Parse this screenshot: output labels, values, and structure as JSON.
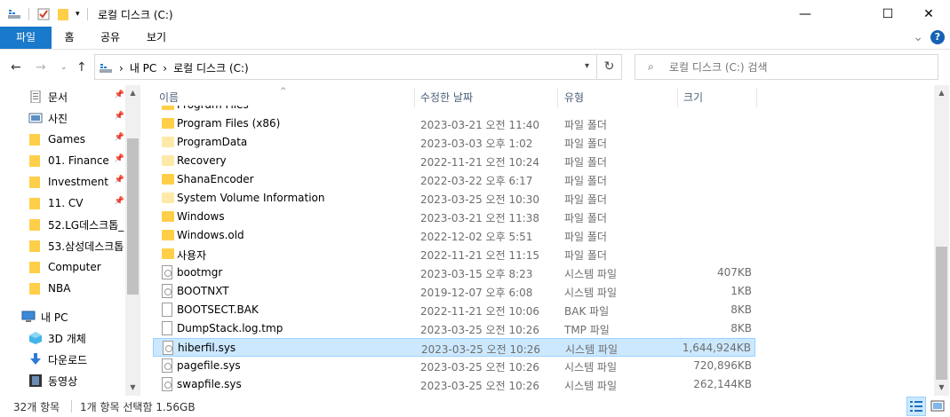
{
  "window": {
    "title": "로컬 디스크 (C:)",
    "minimize_glyph": "—",
    "maximize_glyph": "☐",
    "close_glyph": "✕"
  },
  "ribbon": {
    "tabs": [
      {
        "label": "파일"
      },
      {
        "label": "홈"
      },
      {
        "label": "공유"
      },
      {
        "label": "보기"
      }
    ],
    "help_glyph": "?",
    "expand_glyph": "⌄"
  },
  "address": {
    "crumbs": [
      "내 PC",
      "로컬 디스크 (C:)"
    ],
    "separator": "›"
  },
  "search": {
    "placeholder": "로컬 디스크 (C:) 검색"
  },
  "nav_pane": {
    "items": [
      {
        "label": "문서",
        "icon": "documents-icon",
        "pinned": true
      },
      {
        "label": "사진",
        "icon": "pictures-icon",
        "pinned": true
      },
      {
        "label": "Games",
        "icon": "folder-icon",
        "pinned": true
      },
      {
        "label": "01. Finance",
        "icon": "folder-icon",
        "pinned": true
      },
      {
        "label": "Investment",
        "icon": "folder-icon",
        "pinned": true
      },
      {
        "label": "11. CV",
        "icon": "folder-icon",
        "pinned": true
      },
      {
        "label": "52.LG데스크톱_",
        "icon": "folder-icon",
        "pinned": false
      },
      {
        "label": "53.삼성데스크톱",
        "icon": "folder-icon",
        "pinned": false
      },
      {
        "label": "Computer",
        "icon": "folder-icon",
        "pinned": false
      },
      {
        "label": "NBA",
        "icon": "folder-icon",
        "pinned": false
      },
      {
        "label": "내 PC",
        "icon": "pc-icon",
        "pinned": false
      },
      {
        "label": "3D 개체",
        "icon": "objects-3d-icon",
        "pinned": false
      },
      {
        "label": "다운로드",
        "icon": "download-icon",
        "pinned": false
      },
      {
        "label": "동영상",
        "icon": "video-icon",
        "pinned": false
      }
    ]
  },
  "columns": {
    "name": "이름",
    "date": "수정한 날짜",
    "type": "유형",
    "size": "크기"
  },
  "files": [
    {
      "name": "Program Files",
      "date": "",
      "type": "",
      "size": "",
      "kind": "folder",
      "partial": true
    },
    {
      "name": "Program Files (x86)",
      "date": "2023-03-21 오전 11:40",
      "type": "파일 폴더",
      "size": "",
      "kind": "folder"
    },
    {
      "name": "ProgramData",
      "date": "2023-03-03 오후 1:02",
      "type": "파일 폴더",
      "size": "",
      "kind": "folder-hidden"
    },
    {
      "name": "Recovery",
      "date": "2022-11-21 오전 10:24",
      "type": "파일 폴더",
      "size": "",
      "kind": "folder-hidden"
    },
    {
      "name": "ShanaEncoder",
      "date": "2022-03-22 오후 6:17",
      "type": "파일 폴더",
      "size": "",
      "kind": "folder"
    },
    {
      "name": "System Volume Information",
      "date": "2023-03-25 오전 10:30",
      "type": "파일 폴더",
      "size": "",
      "kind": "folder-hidden"
    },
    {
      "name": "Windows",
      "date": "2023-03-21 오전 11:38",
      "type": "파일 폴더",
      "size": "",
      "kind": "folder"
    },
    {
      "name": "Windows.old",
      "date": "2022-12-02 오후 5:51",
      "type": "파일 폴더",
      "size": "",
      "kind": "folder"
    },
    {
      "name": "사용자",
      "date": "2022-11-21 오전 11:15",
      "type": "파일 폴더",
      "size": "",
      "kind": "folder"
    },
    {
      "name": "bootmgr",
      "date": "2023-03-15 오후 8:23",
      "type": "시스템 파일",
      "size": "407KB",
      "kind": "sys"
    },
    {
      "name": "BOOTNXT",
      "date": "2019-12-07 오후 6:08",
      "type": "시스템 파일",
      "size": "1KB",
      "kind": "sys"
    },
    {
      "name": "BOOTSECT.BAK",
      "date": "2022-11-21 오전 10:06",
      "type": "BAK 파일",
      "size": "8KB",
      "kind": "file"
    },
    {
      "name": "DumpStack.log.tmp",
      "date": "2023-03-25 오전 10:26",
      "type": "TMP 파일",
      "size": "8KB",
      "kind": "file"
    },
    {
      "name": "hiberfil.sys",
      "date": "2023-03-25 오전 10:26",
      "type": "시스템 파일",
      "size": "1,644,924KB",
      "kind": "sys",
      "selected": true
    },
    {
      "name": "pagefile.sys",
      "date": "2023-03-25 오전 10:26",
      "type": "시스템 파일",
      "size": "720,896KB",
      "kind": "sys"
    },
    {
      "name": "swapfile.sys",
      "date": "2023-03-25 오전 10:26",
      "type": "시스템 파일",
      "size": "262,144KB",
      "kind": "sys"
    }
  ],
  "status": {
    "count": "32개 항목",
    "selection": "1개 항목 선택함 1.56GB"
  },
  "colors": {
    "accent": "#1979ca",
    "selection_bg": "#cce8ff",
    "selection_border": "#99d1ff",
    "folder": "#ffcf4a"
  }
}
